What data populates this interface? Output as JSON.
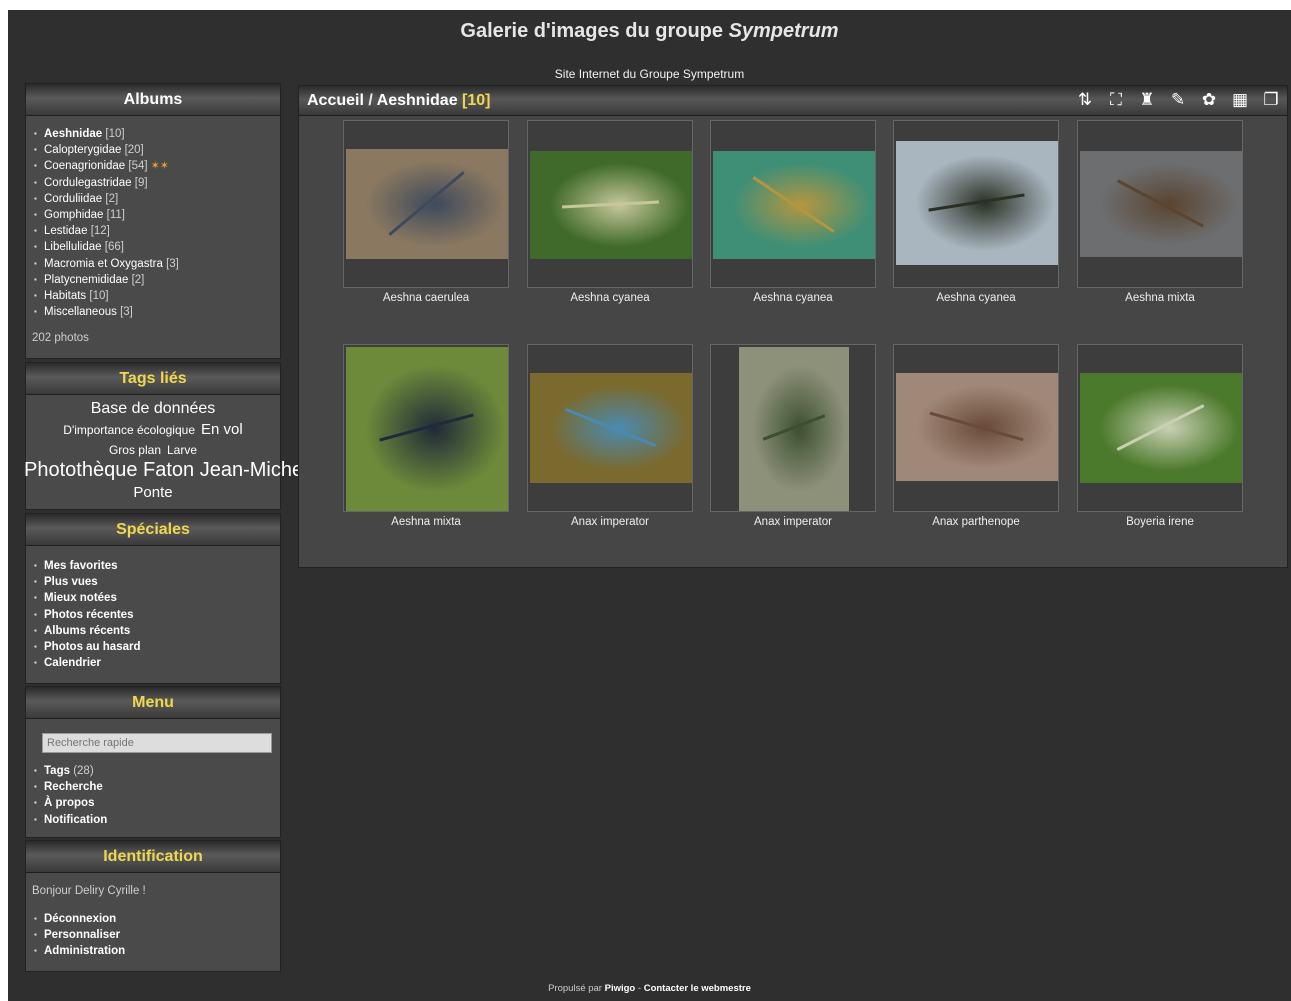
{
  "site": {
    "title_prefix": "Galerie d'images du groupe ",
    "title_em": "Sympetrum",
    "subtitle": "Site Internet du Groupe Sympetrum"
  },
  "albums": {
    "title": "Albums",
    "items": [
      {
        "label": "Aeshnidae",
        "count": "[10]"
      },
      {
        "label": "Calopterygidae",
        "count": "[20]"
      },
      {
        "label": "Coenagrionidae",
        "count": "[54]"
      },
      {
        "label": "Cordulegastridae",
        "count": "[9]"
      },
      {
        "label": "Corduliidae",
        "count": "[2]"
      },
      {
        "label": "Gomphidae",
        "count": "[11]"
      },
      {
        "label": "Lestidae",
        "count": "[12]"
      },
      {
        "label": "Libellulidae",
        "count": "[66]"
      },
      {
        "label": "Macromia et Oxygastra",
        "count": "[3]"
      },
      {
        "label": "Platycnemididae",
        "count": "[2]"
      },
      {
        "label": "Habitats",
        "count": "[10]"
      },
      {
        "label": "Miscellaneous",
        "count": "[3]"
      }
    ],
    "total": "202 photos",
    "new_icon": "new-photos-icon"
  },
  "tags": {
    "title": "Tags liés",
    "items": {
      "t1": "Base de données",
      "t2": "D'importance écologique",
      "t3": "En vol",
      "t4": "Gros plan",
      "t5": "Larve",
      "t6": "Photothèque Faton Jean-Michel",
      "t7": "Ponte"
    }
  },
  "specials": {
    "title": "Spéciales",
    "items": [
      "Mes favorites",
      "Plus vues",
      "Mieux notées",
      "Photos récentes",
      "Albums récents",
      "Photos au hasard",
      "Calendrier"
    ]
  },
  "menu": {
    "title": "Menu",
    "search_placeholder": "Recherche rapide",
    "items": [
      {
        "label": "Tags",
        "count": "(28)"
      },
      {
        "label": "Recherche",
        "count": ""
      },
      {
        "label": "À propos",
        "count": ""
      },
      {
        "label": "Notification",
        "count": ""
      }
    ]
  },
  "identification": {
    "title": "Identification",
    "greeting": "Bonjour Deliry Cyrille !",
    "items": [
      "Déconnexion",
      "Personnaliser",
      "Administration"
    ]
  },
  "content": {
    "crumb_home": "Accueil",
    "crumb_sep": " / ",
    "crumb_album": "Aeshnidae",
    "crumb_count": "[10]",
    "tools": [
      "sort-order-icon",
      "slideshow-icon",
      "caddie-icon",
      "map-icon",
      "favorites-icon",
      "calendar-icon",
      "display-mode-icon"
    ],
    "thumbs": [
      {
        "caption": "Aeshna caerulea",
        "bg": "#8a7860",
        "accent": "#3e4a5c"
      },
      {
        "caption": "Aeshna cyanea",
        "bg": "#3f6a2a",
        "accent": "#c7c89a"
      },
      {
        "caption": "Aeshna cyanea",
        "bg": "#3f8f76",
        "accent": "#b59640"
      },
      {
        "caption": "Aeshna cyanea",
        "bg": "#a9b6c0",
        "accent": "#2a3024"
      },
      {
        "caption": "Aeshna mixta",
        "bg": "#6d6e70",
        "accent": "#5a4530"
      },
      {
        "caption": "Aeshna mixta",
        "bg": "#6d8a3a",
        "accent": "#202a38"
      },
      {
        "caption": "Anax imperator",
        "bg": "#7a6a2e",
        "accent": "#4b8ab0"
      },
      {
        "caption": "Anax imperator",
        "bg": "#8e917a",
        "accent": "#3c5030"
      },
      {
        "caption": "Anax parthenope",
        "bg": "#a08878",
        "accent": "#6a4a3a"
      },
      {
        "caption": "Boyeria irene",
        "bg": "#4c7a2c",
        "accent": "#c9d0b4"
      }
    ]
  },
  "footer": {
    "prefix": "Propulsé par ",
    "pwigo": "Piwigo",
    "sep": " - ",
    "contact": "Contacter le webmestre"
  }
}
